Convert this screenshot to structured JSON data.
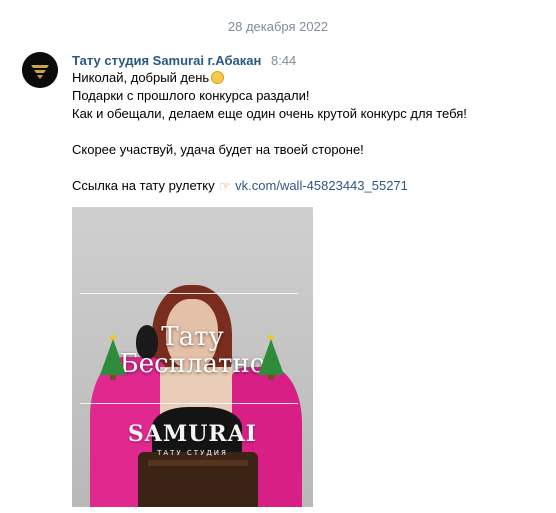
{
  "date_separator": "28 декабря 2022",
  "message": {
    "author": "Тату студия Samurai г.Абакан",
    "time": "8:44",
    "lines": [
      "Николай, добрый день",
      "Подарки с прошлого конкурса раздали!",
      "Как и обещали, делаем еще один очень крутой конкурс для тебя!",
      "Скорее участвуй, удача будет на твоей стороне!",
      "Ссылка на тату рулетку"
    ],
    "link_text": "vk.com/wall-45823443_55271",
    "emojis": [
      "smiling-face-emoji",
      "backhand-index-pointing-right-emoji"
    ]
  },
  "photo": {
    "title_line1": "Тату",
    "title_line2": "Бесплатно",
    "logo_text": "SAMURAI",
    "logo_subtext": "ТАТУ СТУДИЯ"
  },
  "colors": {
    "author": "#2a5885",
    "link": "#2a5885",
    "meta": "#818c99",
    "coat": "#e0288f"
  }
}
